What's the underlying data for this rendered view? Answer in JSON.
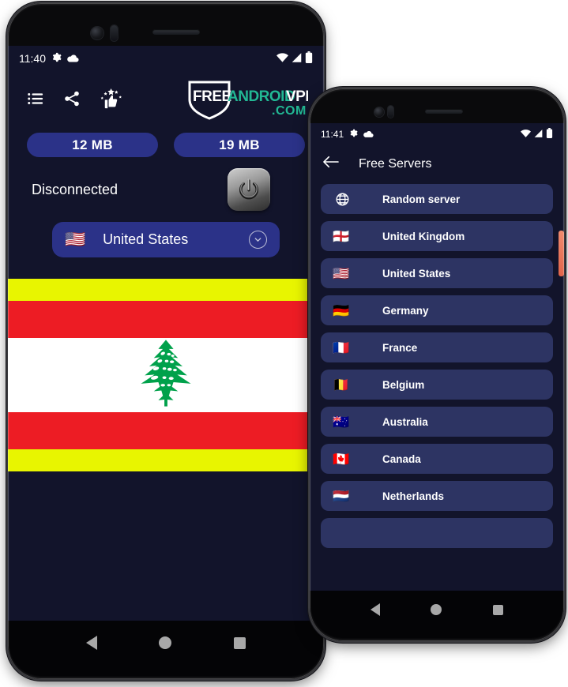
{
  "phones": {
    "left": {
      "status_bar": {
        "time": "11:40",
        "icons_left": [
          "gear-icon",
          "cloud-icon"
        ],
        "icons_right": [
          "wifi-icon",
          "cellular-signal-icon",
          "battery-icon"
        ]
      },
      "toolbar": {
        "icons": [
          "list-icon",
          "share-icon",
          "rate-us-icon"
        ]
      },
      "brand_logo": {
        "part1": "FREE",
        "part2": "ANDROID",
        "part3": "VPN",
        "part4": ".COM",
        "color_white": "#ffffff",
        "color_accent": "#22b894"
      },
      "data_usage": {
        "download_label": "12 MB",
        "upload_label": "19 MB"
      },
      "connection": {
        "status_text": "Disconnected",
        "power_button_name": "power-toggle",
        "power_state": "off"
      },
      "selected_country": {
        "flag": "🇺🇸",
        "name": "United States",
        "chevron": "chevron-down-icon"
      },
      "ad_banner": {
        "type": "flag-image",
        "country": "Lebanon",
        "strip_color": "#e8f500",
        "flag_red": "#ed1c24",
        "flag_white": "#ffffff",
        "cedar_green": "#00a14b"
      },
      "nav_buttons": [
        "back-button",
        "home-button",
        "recents-button"
      ]
    },
    "right": {
      "status_bar": {
        "time": "11:41",
        "icons_left": [
          "gear-icon",
          "cloud-icon"
        ],
        "icons_right": [
          "wifi-icon",
          "cellular-signal-icon",
          "battery-icon"
        ]
      },
      "header": {
        "back_icon": "arrow-back-icon",
        "title": "Free Servers"
      },
      "servers": [
        {
          "flag": "globe-icon",
          "name": "Random server",
          "is_globe": true
        },
        {
          "flag": "🏴󠁧󠁢󠁥󠁮󠁧󠁿",
          "name": "United Kingdom",
          "is_globe": false
        },
        {
          "flag": "🇺🇸",
          "name": "United States",
          "is_globe": false
        },
        {
          "flag": "🇩🇪",
          "name": "Germany",
          "is_globe": false
        },
        {
          "flag": "🇫🇷",
          "name": "France",
          "is_globe": false
        },
        {
          "flag": "🇧🇪",
          "name": "Belgium",
          "is_globe": false
        },
        {
          "flag": "🇦🇺",
          "name": "Australia",
          "is_globe": false
        },
        {
          "flag": "🇨🇦",
          "name": "Canada",
          "is_globe": false
        },
        {
          "flag": "🇳🇱",
          "name": "Netherlands",
          "is_globe": false
        },
        {
          "flag": "",
          "name": "",
          "is_globe": false
        }
      ],
      "side_button_color": "#e8724f",
      "nav_buttons": [
        "back-button",
        "home-button",
        "recents-button"
      ]
    }
  },
  "colors": {
    "screen_bg": "#12142b",
    "pill_blue": "#2b3288",
    "item_blue": "#2d3463",
    "text_white": "#ffffff"
  }
}
